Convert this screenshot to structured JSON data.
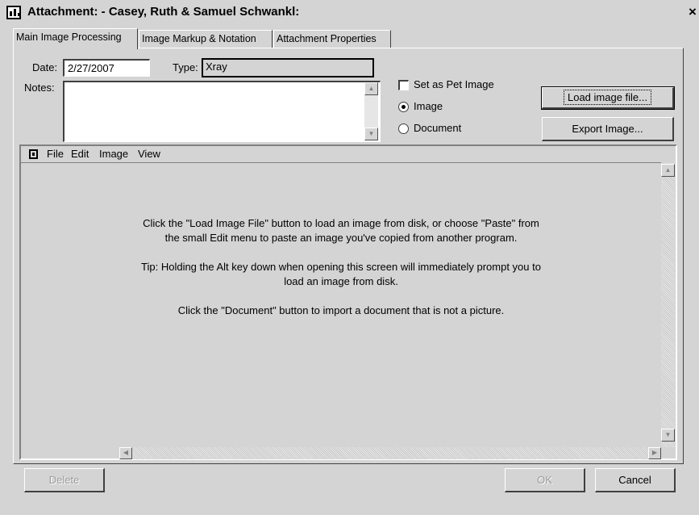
{
  "window": {
    "title": "Attachment:  - Casey, Ruth & Samuel Schwankl:",
    "close_label": "×",
    "icon": "image-attachment-icon"
  },
  "tabs": [
    {
      "label": "Main Image Processing",
      "active": true
    },
    {
      "label": "Image Markup & Notation",
      "active": false
    },
    {
      "label": "Attachment Properties",
      "active": false
    }
  ],
  "form": {
    "date_label": "Date:",
    "date_value": "2/27/2007",
    "type_label": "Type:",
    "type_value": "Xray",
    "notes_label": "Notes:",
    "notes_value": "",
    "set_pet_image_label": "Set as Pet Image",
    "set_pet_image_checked": false,
    "radio_image_label": "Image",
    "radio_document_label": "Document",
    "selected_radio": "Image"
  },
  "buttons": {
    "load_image": "Load image file...",
    "export_image": "Export Image...",
    "delete": "Delete",
    "ok": "OK",
    "cancel": "Cancel"
  },
  "image_menu": {
    "icon": "image-icon",
    "items": [
      "File",
      "Edit",
      "Image",
      "View"
    ]
  },
  "instructions": [
    "Click the \"Load Image File\" button to load an image from disk, or choose \"Paste\" from",
    "the small Edit menu to paste an image you've copied from another program.",
    "Tip: Holding the Alt key down when opening this screen will immediately prompt you to",
    "load an image from disk.",
    "Click the \"Document\" button to import a document that is not a picture."
  ],
  "colors": {
    "window_bg": "#d4d4d4",
    "field_bg": "#ffffff",
    "disabled_text": "#9a9a9a"
  }
}
